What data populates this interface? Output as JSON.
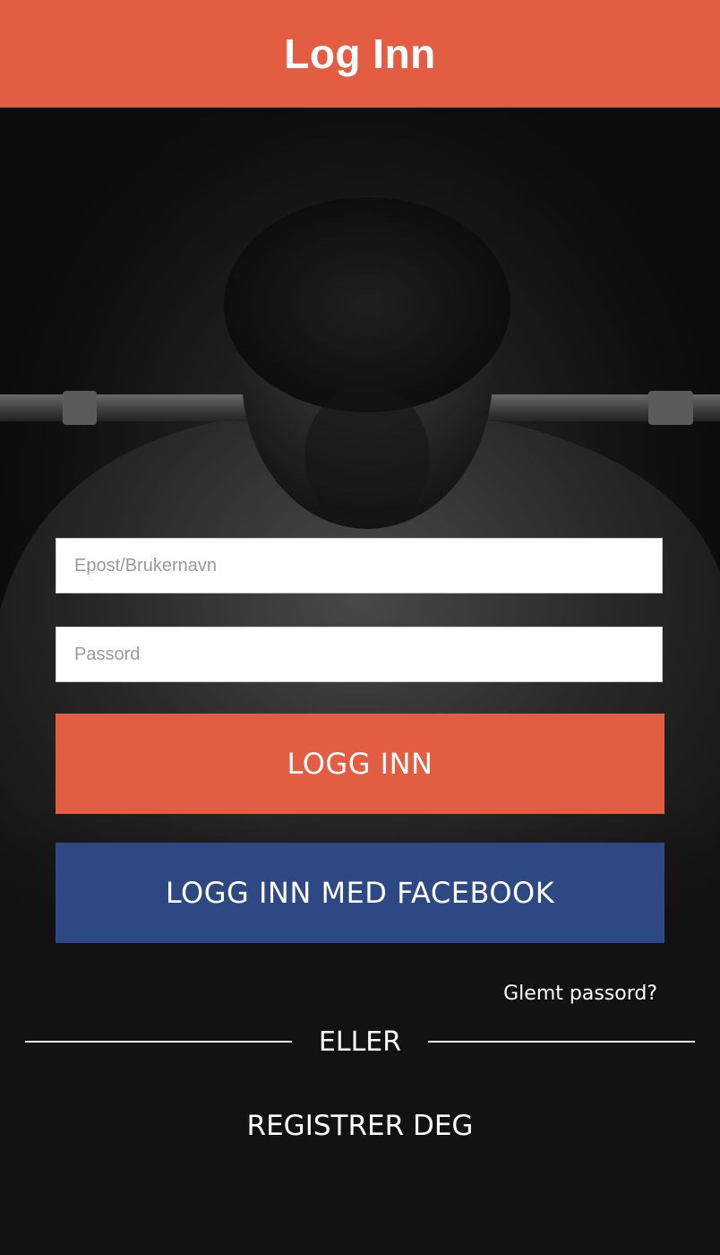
{
  "header": {
    "title": "Log Inn"
  },
  "form": {
    "email_placeholder": "Epost/Brukernavn",
    "email_value": "",
    "password_placeholder": "Passord",
    "password_value": "",
    "login_label": "LOGG INN",
    "facebook_label": "LOGG INN MED FACEBOOK",
    "forgot_label": "Glemt passord?"
  },
  "divider": {
    "label": "ELLER"
  },
  "register": {
    "label": "REGISTRER DEG"
  },
  "colors": {
    "accent": "#e35d42",
    "facebook": "#2e4884",
    "background": "#121212"
  },
  "background_image": {
    "subject": "athlete-with-barbell"
  }
}
